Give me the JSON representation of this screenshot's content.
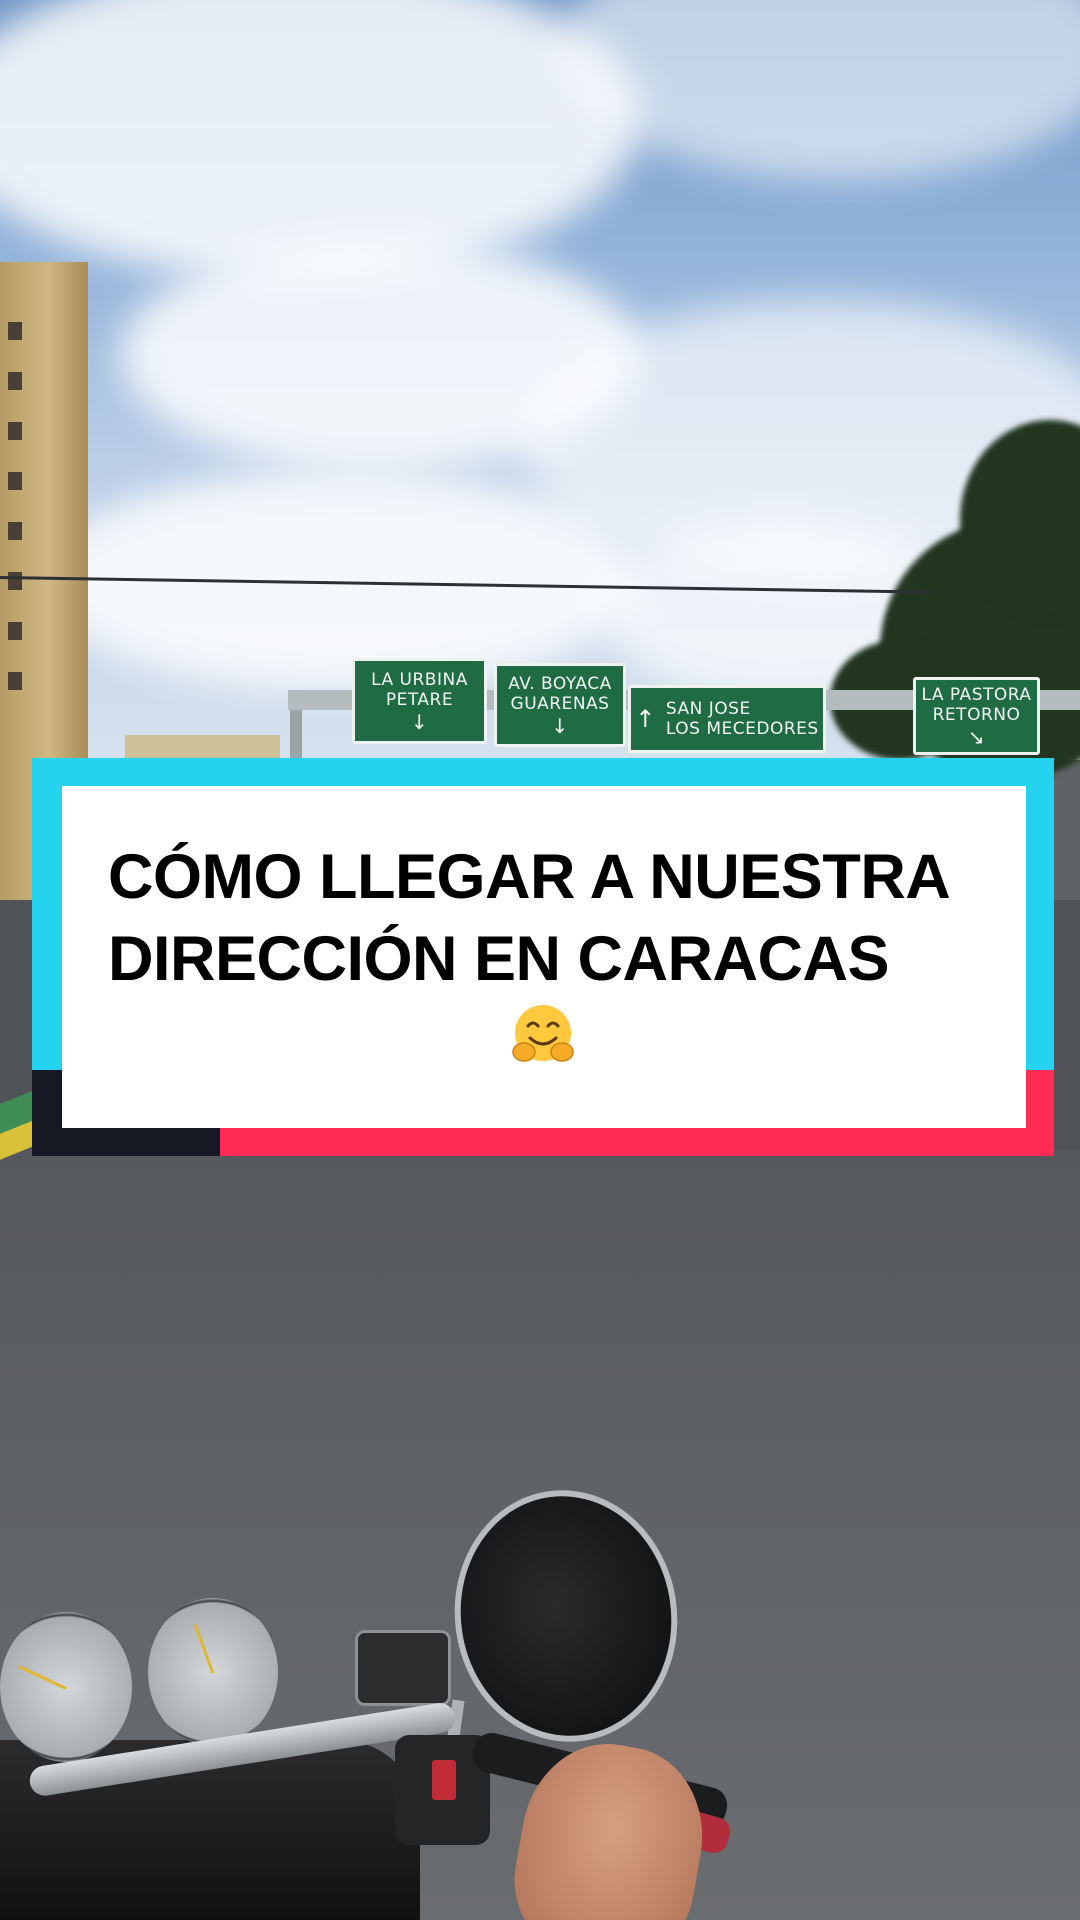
{
  "signs": [
    {
      "line1": "LA URBINA",
      "line2": "PETARE",
      "arrow": "↓"
    },
    {
      "line1": "AV. BOYACA",
      "line2": "GUARENAS",
      "arrow": "↓"
    },
    {
      "line1": "SAN JOSE",
      "line2": "LOS MECEDORES",
      "arrow": "↑"
    },
    {
      "line1": "LA PASTORA",
      "line2": "RETORNO",
      "arrow": "↘"
    }
  ],
  "title_card": {
    "title": "CÓMO LLEGAR A NUESTRA\nDIRECCIÓN EN CARACAS",
    "emoji": "hugging-face-emoji",
    "colors": {
      "cyan": "#25d3ee",
      "red": "#fe2c55",
      "dark": "#161823",
      "card": "#ffffff"
    }
  }
}
